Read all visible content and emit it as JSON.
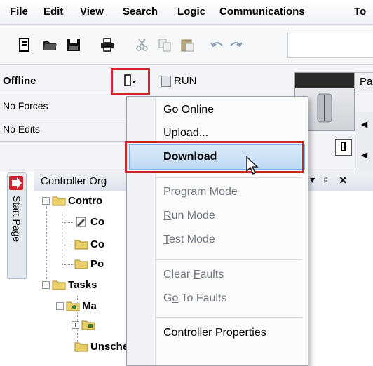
{
  "menu": {
    "items": [
      "File",
      "Edit",
      "View",
      "Search",
      "Logic",
      "Communications",
      "To"
    ]
  },
  "toolbar": {
    "icons": [
      "new-icon",
      "open-icon",
      "save-icon",
      "print-icon",
      "cut-icon",
      "copy-icon",
      "paste-icon",
      "undo-icon",
      "redo-icon"
    ]
  },
  "status": {
    "mode": "Offline",
    "forces": "No Forces",
    "edits": "No Edits",
    "run_label": "RUN",
    "pa_tab": "Pa"
  },
  "organizer": {
    "title": "Controller Org",
    "start_page": "Start Page",
    "tree": [
      {
        "label": "Contro"
      },
      {
        "label": "Co"
      },
      {
        "label": "Co"
      },
      {
        "label": "Po"
      },
      {
        "label": "Tasks"
      },
      {
        "label": "Ma"
      },
      {
        "label": ""
      },
      {
        "label": "Unscheduled"
      }
    ]
  },
  "dropdown": {
    "items": [
      {
        "text": "Go Online",
        "accel": "G",
        "enabled": true
      },
      {
        "text": "Upload...",
        "accel": "U",
        "enabled": true
      },
      {
        "text": "Download",
        "accel": "D",
        "enabled": true,
        "highlighted": true
      },
      {
        "text": "Program Mode",
        "accel": "P",
        "enabled": false
      },
      {
        "text": "Run Mode",
        "accel": "R",
        "enabled": false
      },
      {
        "text": "Test Mode",
        "accel": "T",
        "enabled": false
      },
      {
        "text": "Clear Faults",
        "accel": "F",
        "enabled": false
      },
      {
        "text": "Go To Faults",
        "accel": "o",
        "enabled": false
      },
      {
        "text": "Controller Properties",
        "accel": "n",
        "enabled": true
      }
    ]
  },
  "colors": {
    "highlight_border": "#d0252a",
    "menu_highlight": "#bcd8f5",
    "disabled_text": "#6d7480"
  }
}
